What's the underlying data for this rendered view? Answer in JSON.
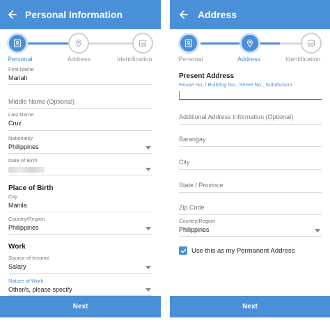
{
  "left": {
    "title": "Personal Information",
    "steps": [
      "Personal",
      "Address",
      "Identification"
    ],
    "fields": {
      "first_name": {
        "label": "First Name",
        "value": "Mariah"
      },
      "middle_name": {
        "placeholder": "Middle Name (Optional)"
      },
      "last_name": {
        "label": "Last Name",
        "value": "Cruz"
      },
      "nationality": {
        "label": "Nationality",
        "value": "Philippines"
      },
      "dob": {
        "label": "Date of Birth"
      }
    },
    "place_of_birth": {
      "title": "Place of Birth",
      "city": {
        "label": "City",
        "value": "Manila"
      },
      "country": {
        "label": "Country/Region",
        "value": "Philippines"
      }
    },
    "work": {
      "title": "Work",
      "income": {
        "label": "Source of Income",
        "value": "Salary"
      },
      "nature": {
        "label": "Nature of Work",
        "value": "Other/s, please specify"
      }
    },
    "next_label": "Next"
  },
  "right": {
    "title": "Address",
    "steps": [
      "Personal",
      "Address",
      "Identification"
    ],
    "present": {
      "title": "Present Address",
      "hint": "House No. / Building No., Street No., Subdivision"
    },
    "fields": {
      "additional": "Additional Address Information (Optional)",
      "barangay": "Barangay",
      "city": "City",
      "state": "State / Province",
      "zip": "Zip Code"
    },
    "country": {
      "label": "Country/Region",
      "value": "Philippines"
    },
    "permanent_label": "Use this as my Permanent Address",
    "next_label": "Next"
  },
  "colors": {
    "accent": "#4a90d9"
  }
}
